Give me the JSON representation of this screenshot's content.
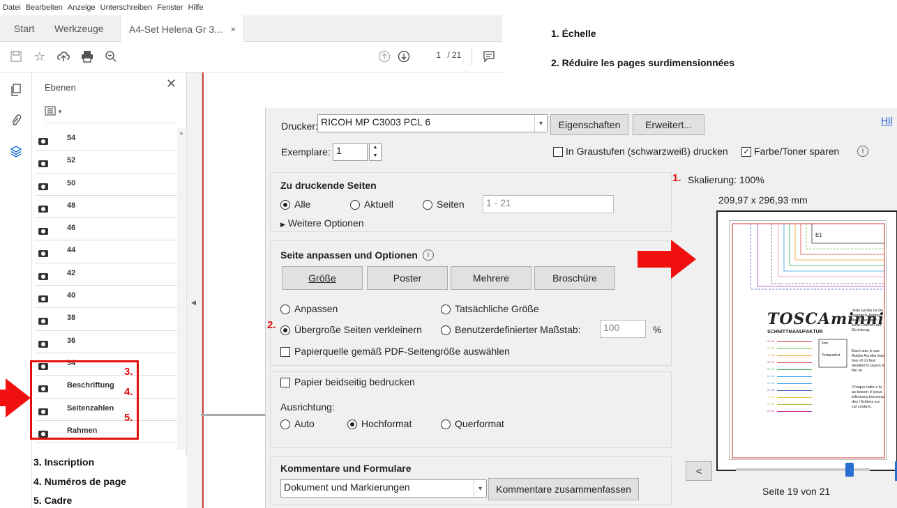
{
  "menu": [
    "Datei",
    "Bearbeiten",
    "Anzeige",
    "Unterschreiben",
    "Fenster",
    "Hilfe"
  ],
  "tabs": {
    "start": "Start",
    "tools": "Werkzeuge",
    "document": "A4-Set Helena Gr 3...",
    "close": "×"
  },
  "toolbar": {
    "page_current": "1",
    "page_total": "/ 21"
  },
  "layers": {
    "title": "Ebenen",
    "close": "✕",
    "options_icon": "options-icon",
    "items": [
      {
        "name": "54"
      },
      {
        "name": "52"
      },
      {
        "name": "50"
      },
      {
        "name": "48"
      },
      {
        "name": "46"
      },
      {
        "name": "44"
      },
      {
        "name": "42"
      },
      {
        "name": "40"
      },
      {
        "name": "38"
      },
      {
        "name": "36"
      },
      {
        "name": "34"
      },
      {
        "name": "Beschriftung"
      },
      {
        "name": "Seitenzahlen"
      },
      {
        "name": "Rahmen"
      }
    ]
  },
  "dialog": {
    "printer_label": "Drucker:",
    "printer_value": "RICOH MP C3003 PCL 6",
    "properties_button": "Eigenschaften",
    "advanced_button": "Erweitert...",
    "help_link": "Hil",
    "copies_label": "Exemplare:",
    "copies_value": "1",
    "grayscale_label": "In Graustufen (schwarzweiß) drucken",
    "grayscale_checked": false,
    "save_toner_label": "Farbe/Toner sparen",
    "save_toner_checked": true,
    "pages_title": "Zu druckende Seiten",
    "pages_all": "Alle",
    "pages_current": "Aktuell",
    "pages_range": "Seiten",
    "pages_range_value": "1 - 21",
    "more_options": "Weitere Optionen",
    "fit_title": "Seite anpassen und Optionen",
    "size_button": "Größe",
    "poster_button": "Poster",
    "multiple_button": "Mehrere",
    "booklet_button": "Broschüre",
    "fit_option": "Anpassen",
    "actual_size_option": "Tatsächliche Größe",
    "shrink_option": "Übergroße Seiten verkleinern",
    "custom_scale_option": "Benutzerdefinierter Maßstab:",
    "custom_scale_value": "100",
    "custom_scale_unit": "%",
    "paper_source_label": "Papierquelle gemäß PDF-Seitengröße auswählen",
    "duplex_label": "Papier beidseitig bedrucken",
    "orientation_label": "Ausrichtung:",
    "orientation_auto": "Auto",
    "orientation_portrait": "Hochformat",
    "orientation_landscape": "Querformat",
    "comments_title": "Kommentare und Formulare",
    "comments_value": "Dokument und Markierungen",
    "summarize_button": "Kommentare zusammenfassen",
    "scaling_label": "Skalierung: 100%",
    "page_size": "209,97 x 296,93 mm",
    "prev_button": "<",
    "page_status": "Seite 19 von 21",
    "page_slider_fraction": 0.85
  },
  "preview": {
    "brand": "TOSCAminni",
    "brand_sub": "SCHNITTMANUFAKTUR",
    "text_de": "Jede Größe ist Du benötigst Adobe, den D terladen kann Dateien auf Eb leitung.",
    "text_en": "Each size is sav Adobe Acroba load free of ch find detailed in layers in the se",
    "text_fr": "Chaque taille e tu as besoin d' peux télécharg trouveras des i fichiers sur cal couture.",
    "square_label": "5cm",
    "square_text": "Testquadrat",
    "marker": "E1",
    "size_labels": [
      "Gr 34",
      "Gr 36",
      "Gr 38",
      "Gr 40",
      "Gr 42",
      "Gr 44",
      "Gr 46",
      "Gr 48",
      "Gr 50",
      "Gr 52",
      "Gr 54"
    ]
  },
  "colors": {
    "accent_red": "#e01010",
    "slider_blue": "#2a6fd0",
    "link_blue": "#1a5ad6"
  },
  "annotations": {
    "top1": "1. Échelle",
    "top2": "2. Réduire les pages surdimensionnées",
    "b3": "3. Inscription",
    "b4": "4. Numéros de page",
    "b5": "5. Cadre",
    "n1": "1.",
    "n2": "2.",
    "n3": "3.",
    "n4": "4.",
    "n5": "5."
  }
}
